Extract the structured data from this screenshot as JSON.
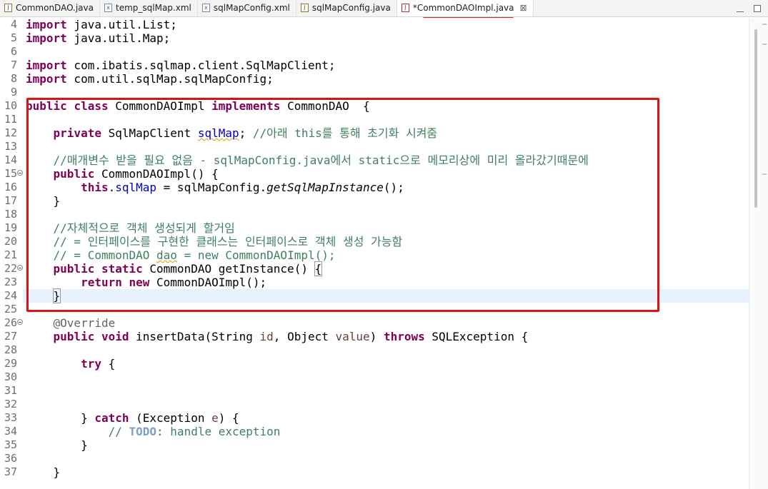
{
  "tabs": [
    {
      "label": "CommonDAO.java",
      "icon": "java-file-icon",
      "active": false
    },
    {
      "label": "temp_sqlMap.xml",
      "icon": "xml-file-icon",
      "active": false
    },
    {
      "label": "sqlMapConfig.xml",
      "icon": "xml-file-icon",
      "active": false
    },
    {
      "label": "sqlMapConfig.java",
      "icon": "java-file-icon",
      "active": false
    },
    {
      "label": "*CommonDAOImpl.java",
      "icon": "java-error-file-icon",
      "active": true,
      "close": "⊠"
    }
  ],
  "highlight_color": "#e01010",
  "editor": {
    "line_numbers": [
      "4",
      "5",
      "6",
      "7",
      "8",
      "9",
      "10",
      "11",
      "12",
      "13",
      "14",
      "15",
      "16",
      "17",
      "18",
      "19",
      "20",
      "21",
      "22",
      "23",
      "24",
      "25",
      "26",
      "27",
      "28",
      "29",
      "30",
      "31",
      "32",
      "33",
      "34",
      "35",
      "36",
      "37"
    ],
    "current_line": "24",
    "folded_lines": [
      "15",
      "22",
      "26"
    ],
    "tokens": {
      "l4_a": "import",
      "l4_b": " java.util.List;",
      "l5_a": "import",
      "l5_b": " java.util.Map;",
      "l7_a": "import",
      "l7_b": " com.ibatis.sqlmap.client.SqlMapClient;",
      "l8_a": "import",
      "l8_b": " com.util.sqlMap.sqlMapConfig;",
      "l10_a": "public",
      "l10_b": " ",
      "l10_c": "class",
      "l10_d": " CommonDAOImpl ",
      "l10_e": "implements",
      "l10_f": " CommonDAO  {",
      "l12_ind": "    ",
      "l12_a": "private",
      "l12_b": " SqlMapClient ",
      "l12_c": "sqlMap",
      "l12_d": "; ",
      "l12_e": "//아래 this를 통해 초기화 시켜줌",
      "l14_ind": "    ",
      "l14_a": "//매개변수 받을 필요 없음 - sqlMapConfig.java에서 static으로 메모리상에 미리 올라갔기때문에",
      "l15_ind": "    ",
      "l15_a": "public",
      "l15_b": " CommonDAOImpl() {",
      "l16_ind": "        ",
      "l16_a": "this",
      "l16_b": ".",
      "l16_c": "sqlMap",
      "l16_d": " = sqlMapConfig.",
      "l16_e": "getSqlMapInstance",
      "l16_f": "();",
      "l17_ind": "    ",
      "l17_a": "}",
      "l19_ind": "    ",
      "l19_a": "//자체적으로 객체 생성되게 할거임",
      "l20_ind": "    ",
      "l20_a": "// = 인터페이스를 구현한 클래스는 인터페이스로 객체 생성 가능함",
      "l21_ind": "    ",
      "l21_a": "// = CommonDAO ",
      "l21_b": "dao",
      "l21_c": " = new CommonDAOImpl();",
      "l22_ind": "    ",
      "l22_a": "public",
      "l22_b": " ",
      "l22_c": "static",
      "l22_d": " CommonDAO getInstance() ",
      "l22_e": "{",
      "l23_ind": "        ",
      "l23_a": "return",
      "l23_b": " ",
      "l23_c": "new",
      "l23_d": " CommonDAOImpl();",
      "l24_ind": "    ",
      "l24_a": "}",
      "l26_ind": "    ",
      "l26_a": "@Override",
      "l27_ind": "    ",
      "l27_a": "public",
      "l27_b": " ",
      "l27_c": "void",
      "l27_d": " insertData(String ",
      "l27_e": "id",
      "l27_f": ", Object ",
      "l27_g": "value",
      "l27_h": ") ",
      "l27_i": "throws",
      "l27_j": " SQLException {",
      "l29_ind": "        ",
      "l29_a": "try",
      "l29_b": " {",
      "l33_ind": "        ",
      "l33_a": "} ",
      "l33_b": "catch",
      "l33_c": " (Exception ",
      "l33_d": "e",
      "l33_e": ") {",
      "l34_ind": "            ",
      "l34_a": "// ",
      "l34_b": "TODO",
      "l34_c": ": handle exception",
      "l35_ind": "        ",
      "l35_a": "}",
      "l37_ind": "    ",
      "l37_a": "}"
    }
  }
}
